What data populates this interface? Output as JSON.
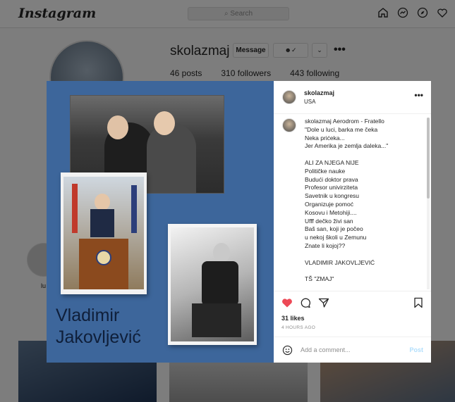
{
  "nav": {
    "logo": "Instagram",
    "search_placeholder": "Search",
    "icons": [
      "home-icon",
      "messenger-icon",
      "explore-icon",
      "heart-icon"
    ]
  },
  "profile": {
    "username": "skolazmaj",
    "message_label": "Message",
    "posts": "46 posts",
    "followers": "310 followers",
    "following": "443 following",
    "highlight_label": "lu"
  },
  "post": {
    "image_title": "Vladimir Jakovljević",
    "username": "skolazmaj",
    "location": "USA",
    "caption_user": "skolazmaj",
    "caption_text": " Aerodrom - Fratello\n\"Dole u luci, barka me čeka\nNeka prićeka...\nJer Amerika je zemlja daleka...\"\n\nALI ZA NJEGA NIJE\nPolitičke nauke\nBudući doktor prava\nProfesor univirziteta\nSavetnik u kongresu\nOrganizuje pomoć\nKosovu i Metohiji....\nUfff dečko živi san\nBaš san, koji je počeo\nu nekoj školi u Zemunu\nZnate li kojoj??\n\nVLADIMIR JAKOVLJEVIĆ\n\nTŠ \"ZMAJ\"",
    "likes": "31 likes",
    "time": "4 HOURS AGO",
    "comment_placeholder": "Add a comment...",
    "post_label": "Post"
  },
  "colors": {
    "image_bg": "#3d669b",
    "like_red": "#ed4956",
    "post_disabled": "#b2dffc"
  }
}
